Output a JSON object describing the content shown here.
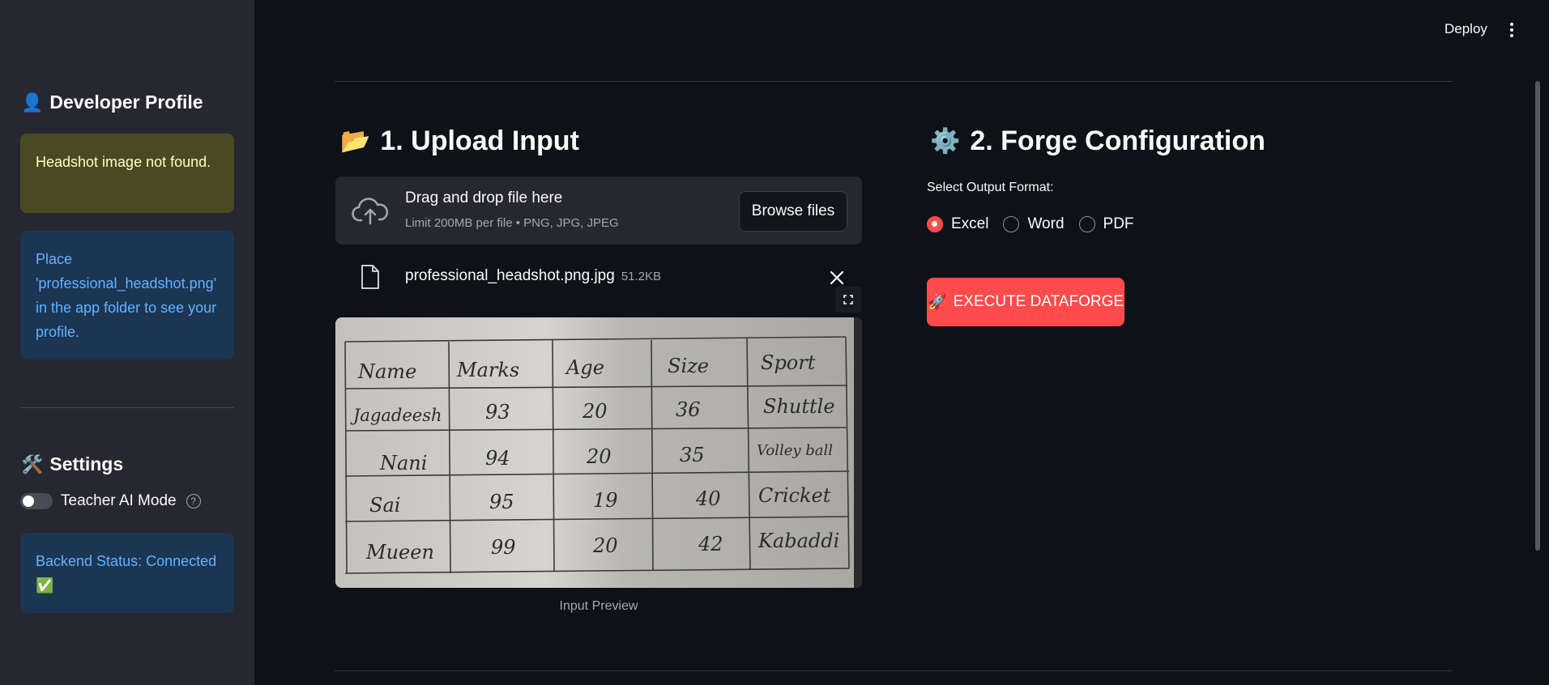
{
  "header": {
    "deploy_label": "Deploy"
  },
  "sidebar": {
    "profile_heading": "Developer Profile",
    "profile_emoji": "👤",
    "warning_text": "Headshot image not found.",
    "info_text": "Place 'professional_headshot.png' in the app folder to see your profile.",
    "settings_heading": "Settings",
    "settings_emoji": "🛠️",
    "toggle_label": "Teacher AI Mode",
    "toggle_on": false,
    "help_icon": "?",
    "status_text": "Backend Status: Connected ✅"
  },
  "upload": {
    "heading": "1. Upload Input",
    "heading_emoji": "📂",
    "drop_title": "Drag and drop file here",
    "drop_limit": "Limit 200MB per file • PNG, JPG, JPEG",
    "browse_label": "Browse files",
    "file_name": "professional_headshot.png.jpg",
    "file_size": "51.2KB",
    "preview_caption": "Input Preview",
    "table_image": {
      "headers": [
        "Name",
        "Marks",
        "Age",
        "Size",
        "Sport"
      ],
      "rows": [
        [
          "Jagadeesh",
          "93",
          "20",
          "36",
          "Shuttle"
        ],
        [
          "Nani",
          "94",
          "20",
          "35",
          "Volley ball"
        ],
        [
          "Sai",
          "95",
          "19",
          "40",
          "Cricket"
        ],
        [
          "Mueen",
          "99",
          "20",
          "42",
          "Kabaddi"
        ]
      ]
    }
  },
  "config": {
    "heading": "2. Forge Configuration",
    "heading_emoji": "⚙️",
    "format_label": "Select Output Format:",
    "options": [
      "Excel",
      "Word",
      "PDF"
    ],
    "selected": "Excel",
    "execute_label": "EXECUTE DATAFORGE",
    "execute_emoji": "🚀"
  },
  "colors": {
    "accent": "#ff4b4b",
    "sidebar_bg": "#262730",
    "main_bg": "#0e1117"
  }
}
